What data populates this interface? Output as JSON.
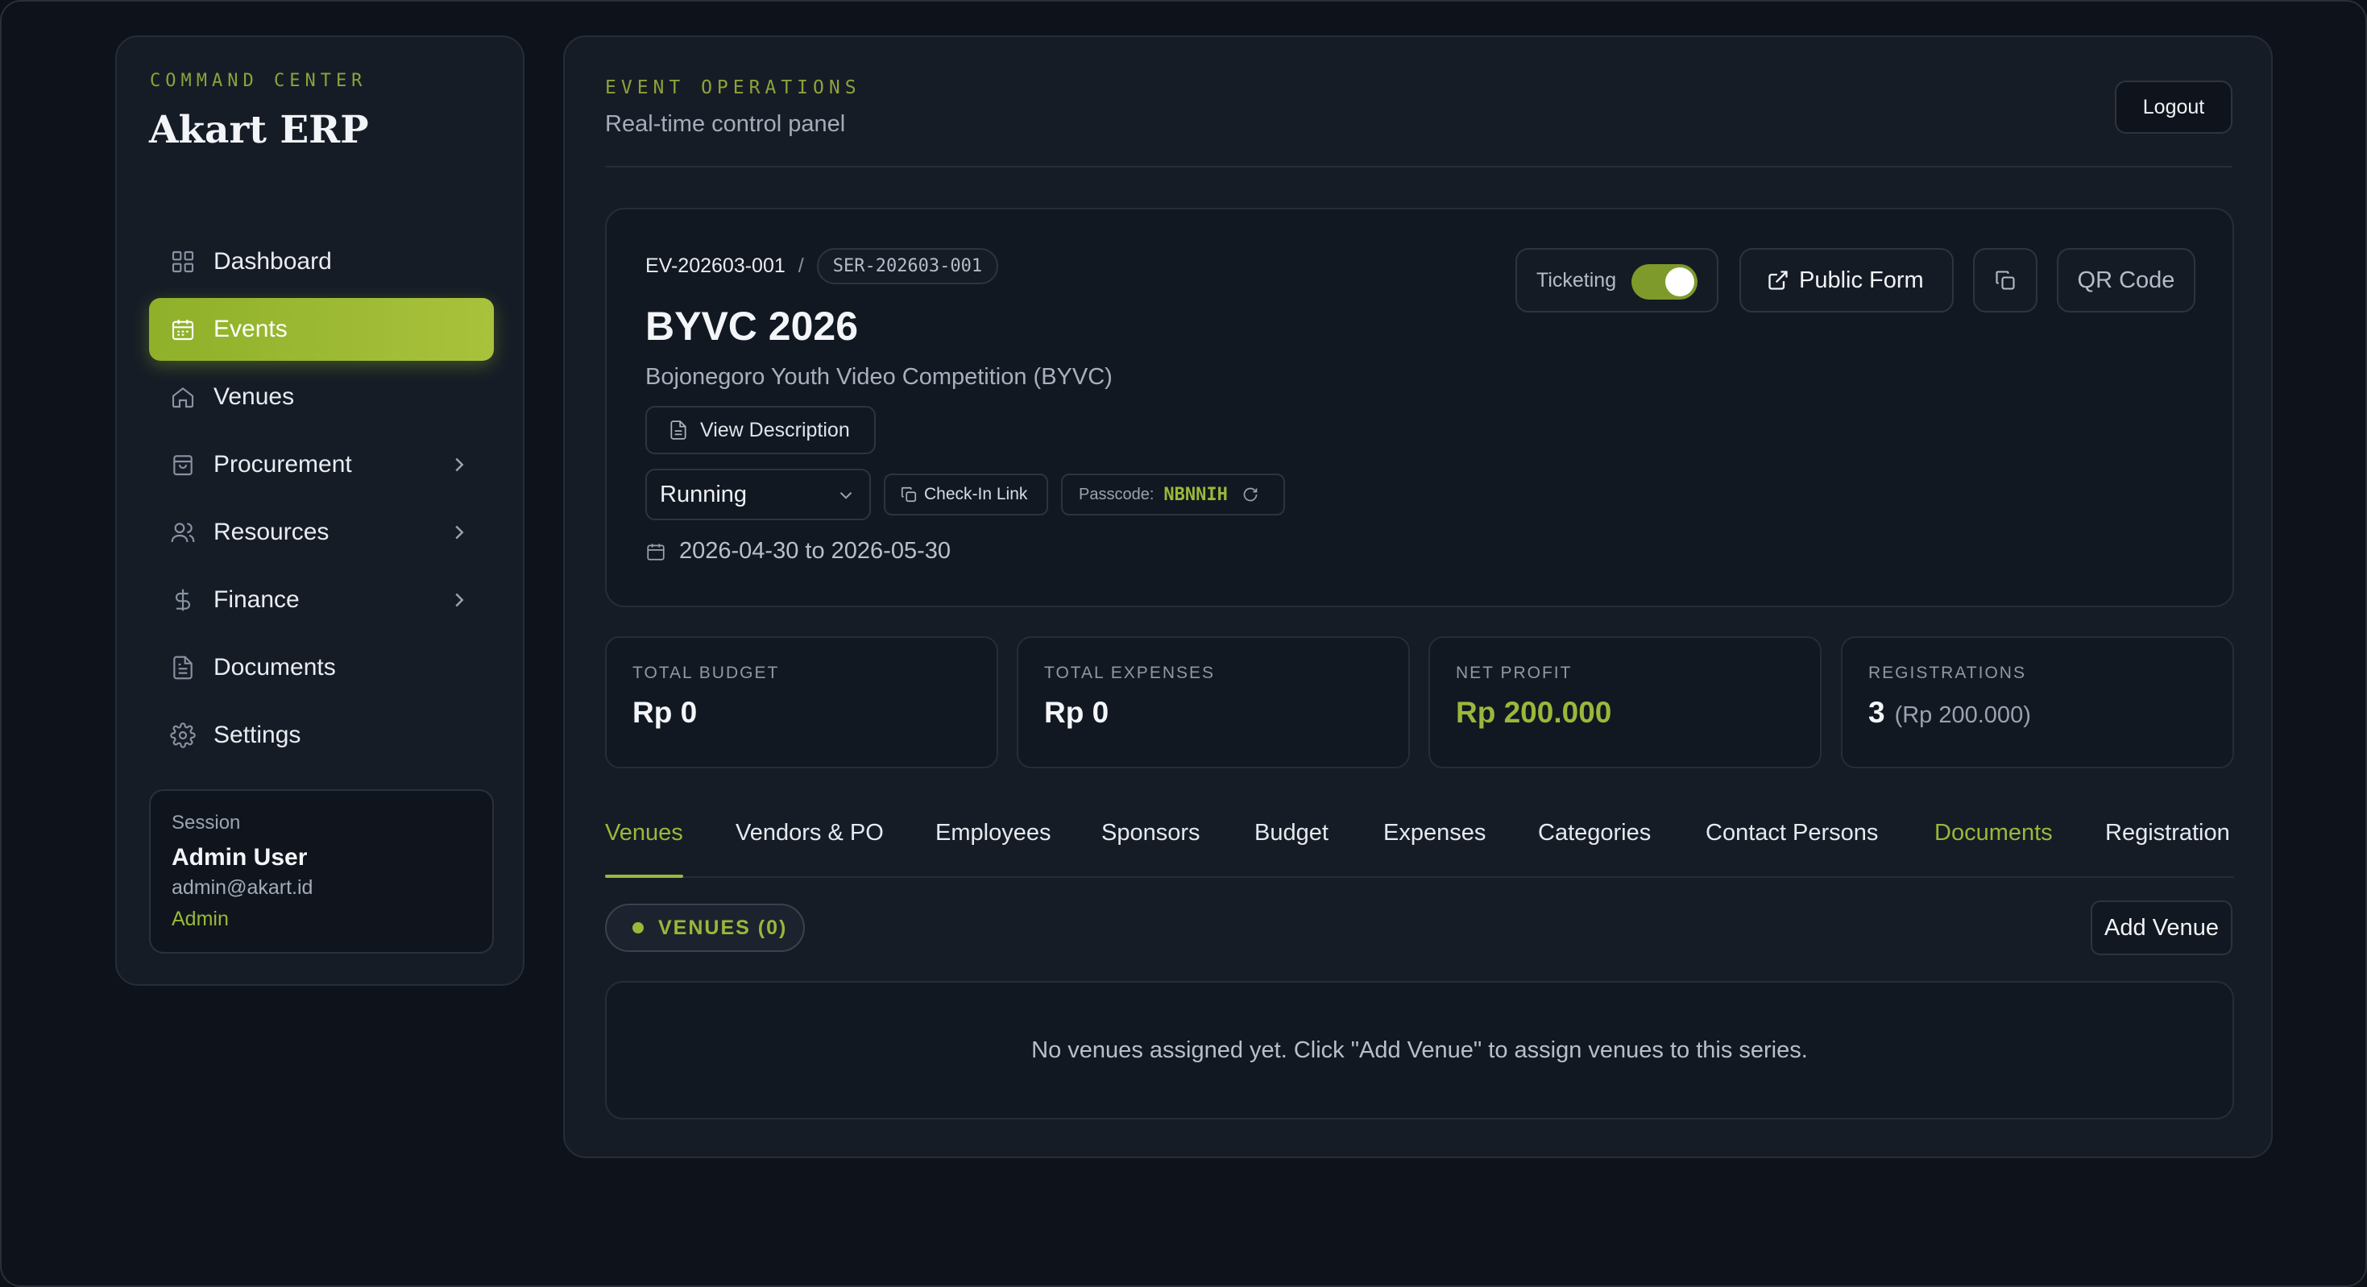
{
  "sidebar": {
    "eyebrow": "COMMAND CENTER",
    "brand": "Akart ERP",
    "items": [
      {
        "label": "Dashboard",
        "icon": "grid-icon",
        "active": false
      },
      {
        "label": "Events",
        "icon": "calendar-icon",
        "active": true
      },
      {
        "label": "Venues",
        "icon": "home-icon",
        "active": false
      },
      {
        "label": "Procurement",
        "icon": "shopping-bag-icon",
        "active": false,
        "has_submenu": true
      },
      {
        "label": "Resources",
        "icon": "users-icon",
        "active": false,
        "has_submenu": true
      },
      {
        "label": "Finance",
        "icon": "dollar-icon",
        "active": false,
        "has_submenu": true
      },
      {
        "label": "Documents",
        "icon": "file-icon",
        "active": false
      },
      {
        "label": "Settings",
        "icon": "gear-icon",
        "active": false
      }
    ],
    "session": {
      "label": "Session",
      "name": "Admin User",
      "email": "admin@akart.id",
      "role": "Admin"
    }
  },
  "header": {
    "eyebrow": "EVENT OPERATIONS",
    "subtitle": "Real-time control panel",
    "logout_label": "Logout"
  },
  "event": {
    "code": "EV-202603-001",
    "separator": "/",
    "series_code": "SER-202603-001",
    "title": "BYVC 2026",
    "subtitle": "Bojonegoro Youth Video Competition (BYVC)",
    "view_description_label": "View Description",
    "status": "Running",
    "checkin_label": "Check-In Link",
    "passcode_label": "Passcode:",
    "passcode_value": "NBNNIH",
    "date_range": "2026-04-30 to 2026-05-30",
    "ticketing_label": "Ticketing",
    "ticketing_enabled": true,
    "public_form_label": "Public Form",
    "qr_code_label": "QR Code"
  },
  "stats": [
    {
      "label": "TOTAL BUDGET",
      "value": "Rp 0"
    },
    {
      "label": "TOTAL EXPENSES",
      "value": "Rp 0"
    },
    {
      "label": "NET PROFIT",
      "value": "Rp 200.000"
    },
    {
      "label": "REGISTRATIONS",
      "value": "3",
      "sub": "(Rp 200.000)"
    }
  ],
  "tabs": [
    "Venues",
    "Vendors & PO",
    "Employees",
    "Sponsors",
    "Budget",
    "Expenses",
    "Categories",
    "Contact Persons",
    "Documents",
    "Registration"
  ],
  "active_tab": "Venues",
  "venues": {
    "pill_label": "VENUES (0)",
    "add_label": "Add Venue",
    "empty_message": "No venues assigned yet. Click \"Add Venue\" to assign venues to this series."
  },
  "colors": {
    "accent": "#9ab83a",
    "background": "#0e121a",
    "panel": "#161c26"
  }
}
